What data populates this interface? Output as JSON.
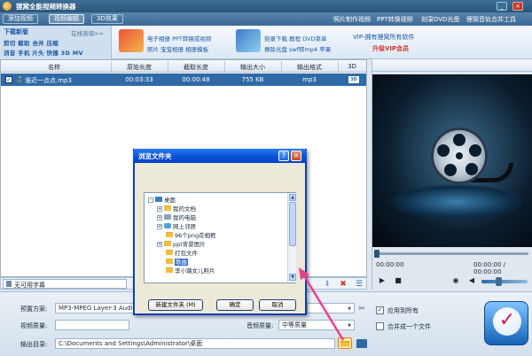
{
  "app": {
    "title": "狸窝全能视频转换器"
  },
  "menu": {
    "tabs": [
      "添加视频",
      "视频编辑",
      "3D效果"
    ],
    "links": [
      "照片制作视频",
      "PPT转换视频",
      "刻录DVD光盘",
      "狸窝音轨合并工具"
    ]
  },
  "promo": {
    "version": "下载新版",
    "online": "在线咨询>>",
    "line1": "剪切 截取 合并 压缩",
    "line2": "消音 手机 片头 快播 3D MV",
    "block1": [
      "电子相册 PPT转换成视频",
      "照片 宝宝相册 相册模板"
    ],
    "block2": [
      "刻录下载 教程 DVD菜单",
      "擦除光盘 swf转mp4 苹果"
    ],
    "vip_line1": "VIP-拥有狸窝所有软件",
    "vip_line2": "升级VIP会员"
  },
  "list": {
    "columns": [
      "名称",
      "原始长度",
      "截取长度",
      "输出大小",
      "输出格式",
      "3D"
    ],
    "rows": [
      {
        "name": "谁近一点点.mp3",
        "original": "00:03:33",
        "clip": "00:00:48",
        "size": "755 KB",
        "format": "mp3",
        "three_d": "3D"
      }
    ]
  },
  "subtitle": {
    "value": "无可用字幕"
  },
  "preview": {
    "time_left": "00:00:00",
    "time_right": "00:00:00 / 00:00:00",
    "volume_level": 0.35
  },
  "bottom": {
    "preset_label": "预置方案:",
    "preset_value": "MP3-MPEG Layer-3 Audio",
    "video_quality_label": "视频质量:",
    "video_quality_value": "",
    "audio_quality_label": "音频质量:",
    "audio_quality_value": "中等质量",
    "output_label": "输出目录:",
    "output_value": "C:\\Documents and Settings\\Administrator\\桌面",
    "apply_all": "应用到所有",
    "merge": "合并成一个文件"
  },
  "dialog": {
    "title": "浏览文件夹",
    "tree": [
      {
        "label": "桌面",
        "level": 0,
        "expander": "-",
        "icon": "desktop"
      },
      {
        "label": "我的文档",
        "level": 1,
        "expander": "+",
        "icon": "folder"
      },
      {
        "label": "我的电脑",
        "level": 1,
        "expander": "+",
        "icon": "computer"
      },
      {
        "label": "网上邻居",
        "level": 1,
        "expander": "+",
        "icon": "network"
      },
      {
        "label": "96个png花相框",
        "level": 1,
        "expander": "",
        "icon": "folder"
      },
      {
        "label": "ppt背景图片",
        "level": 1,
        "expander": "+",
        "icon": "folder"
      },
      {
        "label": "打包文件",
        "level": 1,
        "expander": "",
        "icon": "folder"
      },
      {
        "label": "歌曲",
        "level": 1,
        "expander": "",
        "icon": "folder",
        "selected": true
      },
      {
        "label": "李小璐女儿照片",
        "level": 1,
        "expander": "",
        "icon": "folder"
      }
    ],
    "new_folder": "新建文件夹 (M)",
    "ok": "确定",
    "cancel": "取消"
  },
  "colors": {
    "accent": "#2f6aa6",
    "selection": "#316ac5",
    "pointer": "#e8408c",
    "folder_highlight": "#ef7a22"
  }
}
